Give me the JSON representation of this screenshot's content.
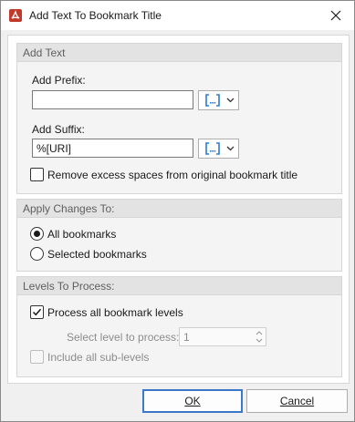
{
  "window": {
    "title": "Add Text To Bookmark Title",
    "icon": "pdf-app-icon",
    "close_icon": "close-icon",
    "accent_color": "#c0392b"
  },
  "add_text_group": {
    "title": "Add Text",
    "prefix_label": "Add Prefix:",
    "prefix_value": "",
    "suffix_label": "Add Suffix:",
    "suffix_value": "%[URI]",
    "macro_button_icon": "insert-macro-icon",
    "macro_dropdown_icon": "chevron-down-icon",
    "remove_spaces_label": "Remove excess spaces from original bookmark title",
    "remove_spaces_checked": false
  },
  "apply_group": {
    "title": "Apply Changes To:",
    "options": [
      {
        "label": "All bookmarks",
        "selected": true
      },
      {
        "label": "Selected bookmarks",
        "selected": false
      }
    ]
  },
  "levels_group": {
    "title": "Levels To Process:",
    "process_all_label": "Process all bookmark levels",
    "process_all_checked": true,
    "select_level_label": "Select level to process:",
    "select_level_value": "1",
    "include_sublevels_label": "Include all sub-levels",
    "include_sublevels_checked": false
  },
  "footer": {
    "ok_label": "OK",
    "cancel_label": "Cancel"
  }
}
